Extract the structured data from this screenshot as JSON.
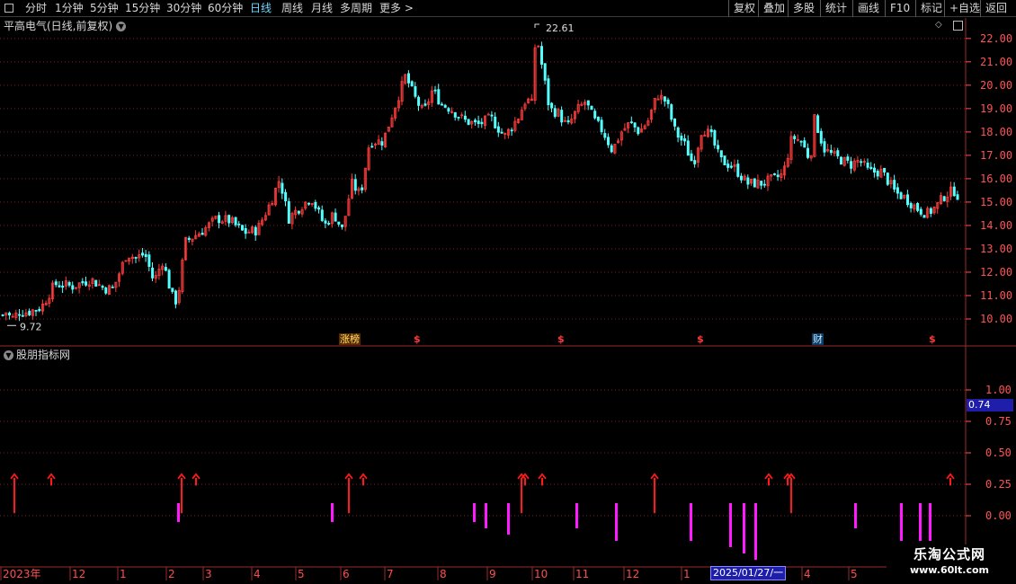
{
  "toolbar": {
    "items": [
      "分时",
      "1分钟",
      "5分钟",
      "15分钟",
      "30分钟",
      "60分钟",
      "日线",
      "周线",
      "月线",
      "多周期",
      "更多 >"
    ],
    "active": "日线",
    "right_items": [
      "复权",
      "叠加",
      "多股",
      "统计",
      "画线",
      "F10",
      "标记",
      "+自选",
      "返回"
    ]
  },
  "main_title": "平高电气(日线,前复权)",
  "indicator_title": "股朋指标网",
  "price_axis": [
    "22.00",
    "21.00",
    "20.00",
    "19.00",
    "18.00",
    "17.00",
    "16.00",
    "15.00",
    "14.00",
    "13.00",
    "12.00",
    "11.00",
    "10.00"
  ],
  "indicator_axis": [
    "1.00",
    "0.75",
    "0.50",
    "0.25",
    "0.00"
  ],
  "current_value": "0.74",
  "high_label": "22.61",
  "low_label": "9.72",
  "badges": [
    {
      "text": "涨榜",
      "kind": "bang"
    },
    {
      "text": "$",
      "kind": "dollar"
    },
    {
      "text": "$",
      "kind": "dollar"
    },
    {
      "text": "$",
      "kind": "dollar"
    },
    {
      "text": "财",
      "kind": "cai"
    },
    {
      "text": "$",
      "kind": "dollar"
    }
  ],
  "date_labels": [
    "2023年",
    "12",
    "1",
    "2",
    "3",
    "4",
    "5",
    "6",
    "7",
    "8",
    "9",
    "10",
    "11",
    "12",
    "1",
    "4",
    "5"
  ],
  "cursor_date": "2025/01/27/一",
  "watermark": {
    "line1": "乐淘公式网",
    "line2": "www.60lt.com"
  },
  "colors": {
    "up": "#ff3c3c",
    "down": "#54ffff",
    "grid": "#7a1f1f",
    "axis": "#ff5454",
    "signal_up": "#ff1a1a",
    "signal_down": "#ff1aff",
    "active": "#6fd6ff"
  },
  "chart_data": {
    "type": "candlestick",
    "price_range": [
      9.5,
      22.8
    ],
    "indicator_range": [
      -0.4,
      1.3
    ],
    "price_path": [
      [
        0,
        10.1
      ],
      [
        6,
        10.3
      ],
      [
        12,
        10.0
      ],
      [
        20,
        10.3
      ],
      [
        30,
        10.3
      ],
      [
        45,
        10.5
      ],
      [
        60,
        11.5
      ],
      [
        80,
        11.4
      ],
      [
        100,
        11.7
      ],
      [
        115,
        11.3
      ],
      [
        125,
        11.3
      ],
      [
        140,
        12.8
      ],
      [
        150,
        12.6
      ],
      [
        160,
        12.8
      ],
      [
        170,
        11.6
      ],
      [
        180,
        12.5
      ],
      [
        190,
        11.0
      ],
      [
        196,
        10.7
      ],
      [
        205,
        13.3
      ],
      [
        225,
        13.8
      ],
      [
        240,
        14.3
      ],
      [
        255,
        14.2
      ],
      [
        270,
        13.7
      ],
      [
        285,
        13.8
      ],
      [
        300,
        15.0
      ],
      [
        310,
        16.0
      ],
      [
        320,
        14.3
      ],
      [
        330,
        14.7
      ],
      [
        345,
        15.2
      ],
      [
        360,
        14.0
      ],
      [
        370,
        14.5
      ],
      [
        380,
        13.8
      ],
      [
        390,
        15.8
      ],
      [
        400,
        15.3
      ],
      [
        410,
        17.6
      ],
      [
        425,
        17.6
      ],
      [
        440,
        19.3
      ],
      [
        450,
        20.4
      ],
      [
        460,
        19.5
      ],
      [
        470,
        18.8
      ],
      [
        480,
        19.8
      ],
      [
        490,
        19.2
      ],
      [
        500,
        19.0
      ],
      [
        515,
        18.5
      ],
      [
        530,
        18.3
      ],
      [
        545,
        18.6
      ],
      [
        560,
        17.8
      ],
      [
        575,
        18.6
      ],
      [
        585,
        19.5
      ],
      [
        590,
        19.0
      ],
      [
        595,
        22.3
      ],
      [
        600,
        21.2
      ],
      [
        610,
        19.0
      ],
      [
        620,
        18.8
      ],
      [
        630,
        18.2
      ],
      [
        640,
        18.9
      ],
      [
        650,
        19.3
      ],
      [
        660,
        18.5
      ],
      [
        670,
        18.0
      ],
      [
        680,
        17.2
      ],
      [
        690,
        18.0
      ],
      [
        700,
        18.4
      ],
      [
        710,
        18.0
      ],
      [
        720,
        18.5
      ],
      [
        730,
        19.6
      ],
      [
        740,
        19.3
      ],
      [
        750,
        18.0
      ],
      [
        760,
        17.5
      ],
      [
        770,
        16.6
      ],
      [
        780,
        18.2
      ],
      [
        790,
        17.8
      ],
      [
        800,
        16.8
      ],
      [
        815,
        16.5
      ],
      [
        830,
        15.8
      ],
      [
        845,
        15.8
      ],
      [
        860,
        16.0
      ],
      [
        870,
        16.2
      ],
      [
        880,
        17.8
      ],
      [
        890,
        17.6
      ],
      [
        900,
        16.8
      ],
      [
        905,
        18.6
      ],
      [
        915,
        17.3
      ],
      [
        925,
        17.0
      ],
      [
        935,
        16.8
      ],
      [
        945,
        16.6
      ],
      [
        955,
        16.8
      ],
      [
        965,
        16.3
      ],
      [
        980,
        16.3
      ],
      [
        995,
        15.4
      ],
      [
        1005,
        15.2
      ],
      [
        1020,
        14.7
      ],
      [
        1030,
        14.5
      ],
      [
        1040,
        14.8
      ],
      [
        1050,
        15.3
      ],
      [
        1060,
        15.5
      ],
      [
        1066,
        15.2
      ]
    ],
    "signals_up": [
      16,
      57,
      202,
      218,
      388,
      404,
      580,
      584,
      603,
      728,
      855,
      876,
      880,
      1057
    ],
    "signals_down": [
      [
        198,
        0.1,
        -0.05
      ],
      [
        369,
        0.1,
        -0.05
      ],
      [
        527,
        0.1,
        -0.05
      ],
      [
        540,
        0.1,
        -0.1
      ],
      [
        565,
        0.1,
        -0.15
      ],
      [
        641,
        0.1,
        -0.1
      ],
      [
        685,
        0.1,
        -0.2
      ],
      [
        768,
        0.1,
        -0.2
      ],
      [
        812,
        0.1,
        -0.25
      ],
      [
        827,
        0.1,
        -0.3
      ],
      [
        840,
        0.1,
        -0.35
      ],
      [
        951,
        0.1,
        -0.1
      ],
      [
        1002,
        0.1,
        -0.2
      ],
      [
        1023,
        0.1,
        -0.2
      ],
      [
        1034,
        0.1,
        -0.2
      ]
    ]
  }
}
